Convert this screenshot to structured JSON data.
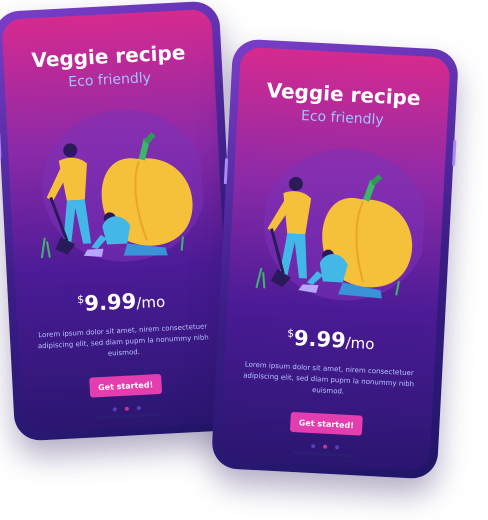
{
  "cards": [
    {
      "title": "Veggie recipe",
      "subtitle": "Eco friendly",
      "price": {
        "currency": "$",
        "amount": "9.99",
        "period": "/mo"
      },
      "description": "Lorem ipsum dolor sit amet, nirem consectetuer adipiscing elit, sed diam pupm la nonummy nibh euismod.",
      "cta_label": "Get started!",
      "dots_count": 3,
      "active_dot": 1
    },
    {
      "title": "Veggie recipe",
      "subtitle": "Eco friendly",
      "price": {
        "currency": "$",
        "amount": "9.99",
        "period": "/mo"
      },
      "description": "Lorem ipsum dolor sit amet, nirem consectetuer adipiscing elit, sed diam pupm la nonummy nibh euismod.",
      "cta_label": "Get started!",
      "dots_count": 3,
      "active_dot": 1
    }
  ],
  "icons": {
    "illustration": "gardening-illustration-icon"
  },
  "colors": {
    "screen_top": "#d62a8f",
    "screen_bottom": "#2a1670",
    "subtitle": "#9fc2ff",
    "description": "#b7c3ff",
    "button": "#e33daf",
    "pepper": "#f6c13a",
    "dot_active": "#c0398f",
    "dot": "#5c3db8"
  }
}
